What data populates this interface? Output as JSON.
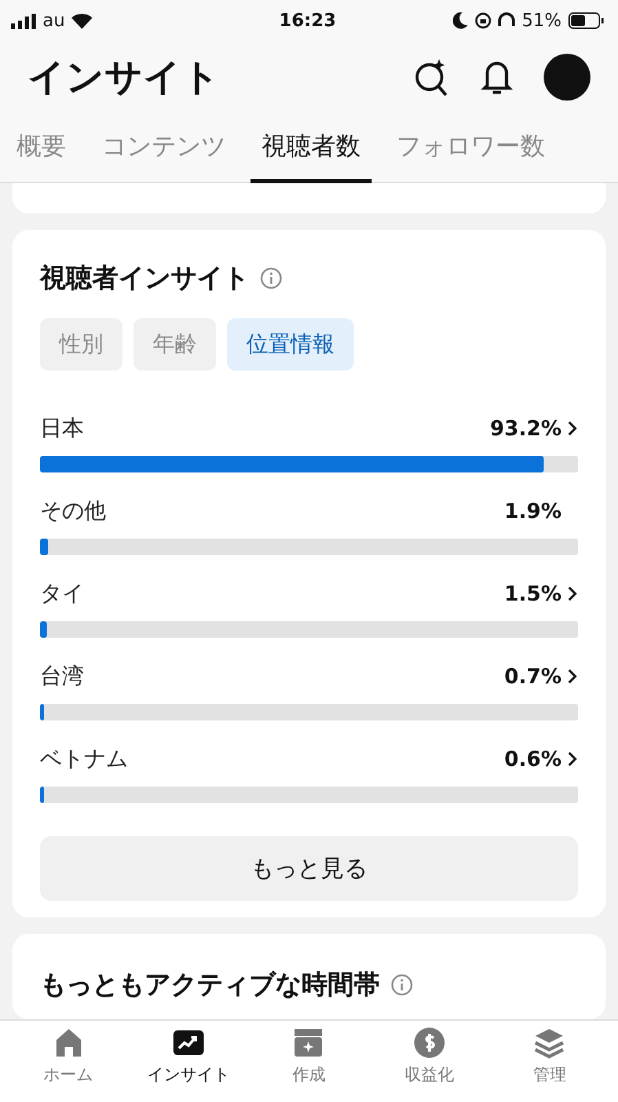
{
  "status_bar": {
    "carrier": "au",
    "time": "16:23",
    "battery": "51%"
  },
  "header": {
    "title": "インサイト"
  },
  "tabs": [
    {
      "label": "概要",
      "selected": false
    },
    {
      "label": "コンテンツ",
      "selected": false
    },
    {
      "label": "視聴者数",
      "selected": true
    },
    {
      "label": "フォロワー数",
      "selected": false
    }
  ],
  "audience_card": {
    "title": "視聴者インサイト",
    "filters": [
      {
        "label": "性別",
        "selected": false
      },
      {
        "label": "年齢",
        "selected": false
      },
      {
        "label": "位置情報",
        "selected": true
      }
    ],
    "rows": [
      {
        "label": "日本",
        "value": "93.2%",
        "level": 0.936,
        "chevron": true
      },
      {
        "label": "その他",
        "value": "1.9%",
        "level": 0.016,
        "chevron": false
      },
      {
        "label": "タイ",
        "value": "1.5%",
        "level": 0.013,
        "chevron": true
      },
      {
        "label": "台湾",
        "value": "0.7%",
        "level": 0.006,
        "chevron": true
      },
      {
        "label": "ベトナム",
        "value": "0.6%",
        "level": 0.005,
        "chevron": true
      }
    ],
    "more_button": "もっと見る"
  },
  "active_time_card": {
    "title": "もっともアクティブな時間帯"
  },
  "bottom_nav": [
    {
      "label": "ホーム",
      "kind": "home",
      "selected": false
    },
    {
      "label": "インサイト",
      "kind": "insights",
      "selected": true
    },
    {
      "label": "作成",
      "kind": "create",
      "selected": false
    },
    {
      "label": "収益化",
      "kind": "money",
      "selected": false
    },
    {
      "label": "管理",
      "kind": "layers",
      "selected": false
    }
  ]
}
